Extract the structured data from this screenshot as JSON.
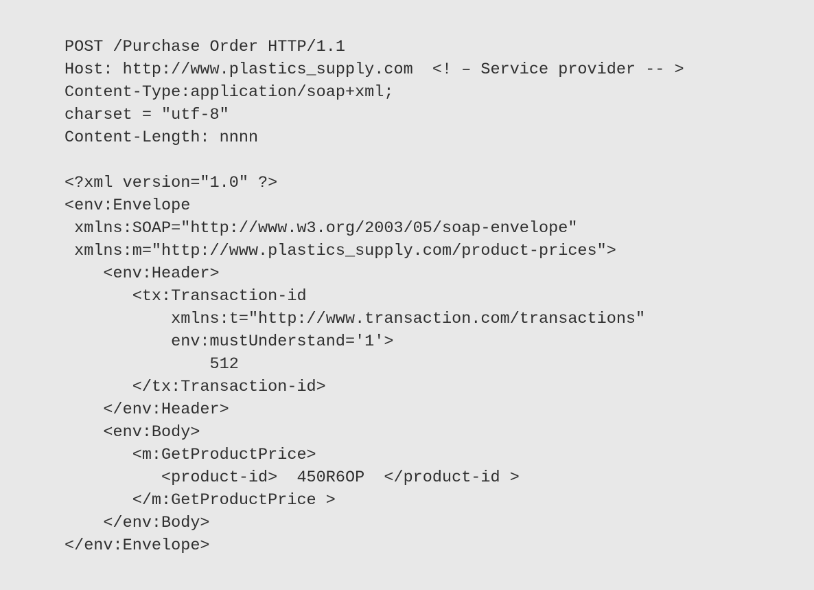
{
  "code": {
    "lines": [
      "POST /Purchase Order HTTP/1.1",
      "Host: http://www.plastics_supply.com  <! – Service provider -- >",
      "Content-Type:application/soap+xml;",
      "charset = \"utf-8\"",
      "Content-Length: nnnn",
      "",
      "<?xml version=\"1.0\" ?>",
      "<env:Envelope",
      " xmlns:SOAP=\"http://www.w3.org/2003/05/soap-envelope\"",
      " xmlns:m=\"http://www.plastics_supply.com/product-prices\">",
      "    <env:Header>",
      "       <tx:Transaction-id",
      "           xmlns:t=\"http://www.transaction.com/transactions\"",
      "           env:mustUnderstand='1'>",
      "               512",
      "       </tx:Transaction-id>",
      "    </env:Header>",
      "    <env:Body>",
      "       <m:GetProductPrice>",
      "          <product-id>  450R6OP  </product-id >",
      "       </m:GetProductPrice >",
      "    </env:Body>",
      "</env:Envelope>"
    ]
  }
}
